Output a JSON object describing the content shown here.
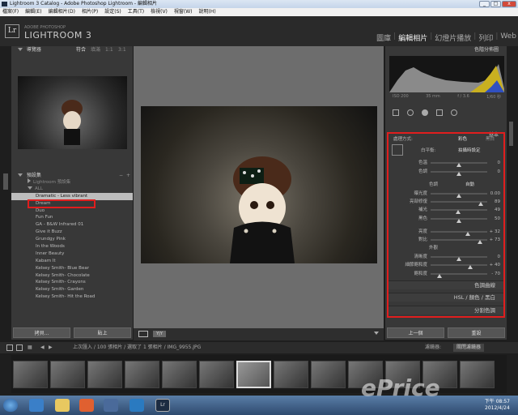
{
  "window": {
    "title": "Lightroom 3 Catalog - Adobe Photoshop Lightroom - 編輯相片"
  },
  "menu": [
    "檔案(F)",
    "編輯(E)",
    "編輯相片(D)",
    "相片(P)",
    "設定(S)",
    "工具(T)",
    "檢視(V)",
    "視窗(W)",
    "說明(H)"
  ],
  "brand": {
    "adobe": "ADOBE PHOTOSHOP",
    "name": "LIGHTROOM 3",
    "logo": "Lr"
  },
  "modules": [
    "圖庫",
    "編輯相片",
    "幻燈片播放",
    "列印",
    "Web"
  ],
  "left": {
    "navigator": {
      "title": "導覽器",
      "zoom_fit": "符合",
      "zoom_fill": "填滿",
      "zoom_1": "1:1",
      "zoom_3": "3:1"
    },
    "presets": {
      "title": "預設集",
      "items": [
        {
          "label": "Lightroom 預設集",
          "type": "folder"
        },
        {
          "label": "ALL",
          "type": "folder-open"
        },
        {
          "label": "Dramatic - Less vibrant",
          "type": "item",
          "selected": true
        },
        {
          "label": "Dream",
          "type": "item"
        },
        {
          "label": "Duo",
          "type": "item"
        },
        {
          "label": "Fun Fun",
          "type": "item"
        },
        {
          "label": "GA - B&W Infrared 01",
          "type": "item"
        },
        {
          "label": "Give it Buzz",
          "type": "item"
        },
        {
          "label": "Grundgy Pink",
          "type": "item"
        },
        {
          "label": "In the Woods",
          "type": "item"
        },
        {
          "label": "Inner Beauty",
          "type": "item"
        },
        {
          "label": "Kabam It",
          "type": "item"
        },
        {
          "label": "Kelsey Smith- Blue Bear",
          "type": "item"
        },
        {
          "label": "Kelsey Smith- Chocolate",
          "type": "item"
        },
        {
          "label": "Kelsey Smith- Crayons",
          "type": "item"
        },
        {
          "label": "Kelsey Smith- Garden",
          "type": "item"
        },
        {
          "label": "Kelsey Smith- Hit the Road",
          "type": "item"
        }
      ]
    },
    "copy_label": "拷貝...",
    "paste_label": "貼上"
  },
  "right": {
    "histogram": {
      "title": "色階分佈圖",
      "iso": "ISO 200",
      "focal": "35 mm",
      "aperture": "f / 3.6",
      "shutter": "1/60 秒"
    },
    "basic": {
      "title": "基本",
      "treatment_label": "處理方式:",
      "color": "彩色",
      "bw": "黑白",
      "wb_label": "白平衡:",
      "wb_value": "拍攝時設定",
      "tone_label": "色調",
      "auto": "自動",
      "presence_label": "外觀",
      "sliders": [
        {
          "label": "色溫",
          "value": "0",
          "pos": 0.5
        },
        {
          "label": "色調",
          "value": "0",
          "pos": 0.5
        },
        {
          "label": "曝光度",
          "value": "0.00",
          "pos": 0.5
        },
        {
          "label": "亮部修復",
          "value": "89",
          "pos": 0.89
        },
        {
          "label": "補光",
          "value": "49",
          "pos": 0.49
        },
        {
          "label": "黑色",
          "value": "50",
          "pos": 0.5
        },
        {
          "label": "亮度",
          "value": "+ 32",
          "pos": 0.66
        },
        {
          "label": "對比",
          "value": "+ 73",
          "pos": 0.87
        },
        {
          "label": "清晰度",
          "value": "0",
          "pos": 0.5
        },
        {
          "label": "細節飽和度",
          "value": "+ 40",
          "pos": 0.7
        },
        {
          "label": "飽和度",
          "value": "- 70",
          "pos": 0.15
        }
      ]
    },
    "sections": [
      "色調曲線",
      "HSL / 顏色 / 黑白",
      "分割色調"
    ],
    "prev_label": "上一個",
    "reset_label": "重設"
  },
  "filmstrip": {
    "info": "上次匯入 / 100 張相片 / 選取了 1 張相片 / IMG_9955.JPG",
    "filter_label": "濾鏡器:",
    "filter_value": "關閉濾鏡器"
  },
  "taskbar": {
    "time": "下午 08:57",
    "date": "2012/4/24"
  },
  "watermark": "ePrice"
}
